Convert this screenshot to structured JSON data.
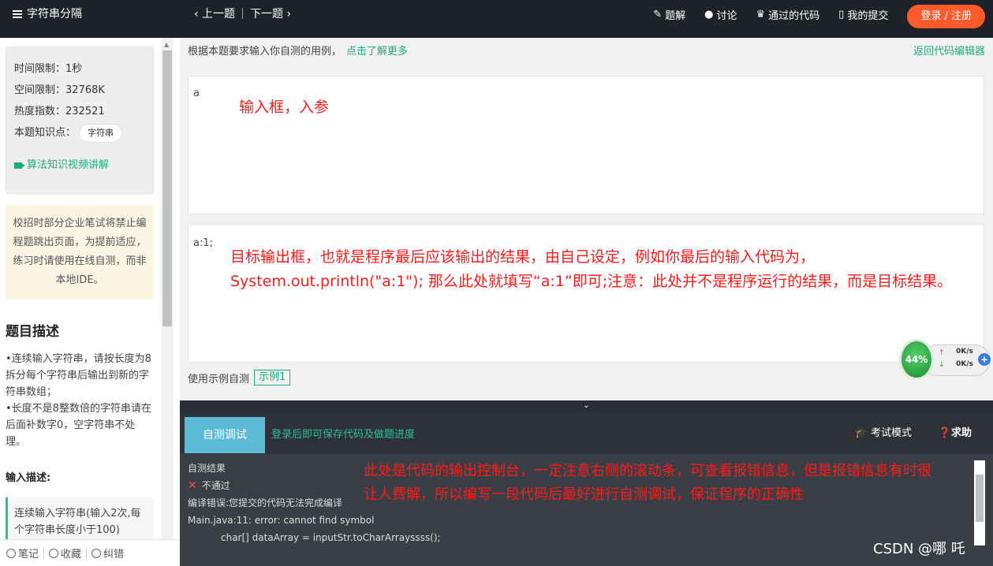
{
  "topbar": {
    "title": "字符串分隔",
    "prev": "‹ 上一题",
    "next": "下一题 ›",
    "links": [
      {
        "icon": "edit-icon",
        "label": "题解"
      },
      {
        "icon": "chat-icon",
        "label": "讨论"
      },
      {
        "icon": "trophy-icon",
        "label": "通过的代码"
      },
      {
        "icon": "file-icon",
        "label": "我的提交"
      }
    ],
    "login": "登录 / 注册"
  },
  "sidebar": {
    "time_limit": "时间限制：1秒",
    "space_limit": "空间限制：32768K",
    "heat": "热度指数：232521",
    "knowledge_label": "本题知识点：",
    "knowledge_tag": "字符串",
    "video_link": "算法知识视频讲解",
    "warning": "校招时部分企业笔试将禁止编程题跳出页面，为提前适应，练习时请使用在线自测，而非本地IDE。",
    "desc_title": "题目描述",
    "desc_lines": [
      "•连续输入字符串，请按长度为8拆分每个字符串后输出到新的字符串数组；",
      "•长度不是8整数倍的字符串请在后面补数字0，空字符串不处理。"
    ],
    "input_title": "输入描述:",
    "input_desc": "连续输入字符串(输入2次,每个字符串长度小于100)",
    "footer": [
      "笔记",
      "收藏",
      "纠错"
    ]
  },
  "main": {
    "hint": "根据本题要求输入你自测的用例，",
    "hint_more": "点击了解更多",
    "back": "返回代码编辑器",
    "input_value": "a",
    "input_annotation": "输入框，入参",
    "output_value": "a:1;",
    "output_annotation_1": "目标输出框，也就是程序最后应该输出的结果，由自己设定，例如你最后的输入代码为，",
    "output_annotation_2": "System.out.println(\"a:1\"); 那么此处就填写“a:1”即可;注意：此处并不是程序运行的结果，而是目标结果。",
    "example_label": "使用示例自测",
    "example_tag": "示例1"
  },
  "network": {
    "percent": "44%",
    "up": "0K/s",
    "down": "0K/s"
  },
  "console": {
    "run_button": "自测调试",
    "login_hint": "登录后即可保存代码及做题进度",
    "exam_mode": "考试模式",
    "help": "求助",
    "result_title": "自测结果",
    "result_status": "不通过",
    "compile_error": "编译错误:您提交的代码无法完成编译",
    "error_line": "Main.java:11: error: cannot find symbol",
    "code_line": "char[] dataArray = inputStr.toCharArrayssss();",
    "annotation_1": "此处是代码的输出控制台，一定注意右侧的滚动条，可查看报错信息，但是报错信息有时很",
    "annotation_2": "让人费解，所以编写一段代码后最好进行自测调试，保证程序的正确性"
  },
  "watermark": "CSDN @哪 吒",
  "colors": {
    "accent": "#1fad76",
    "annotation": "#ff1a1a",
    "login": "#ff5a2b",
    "topbar": "#1f2228"
  }
}
